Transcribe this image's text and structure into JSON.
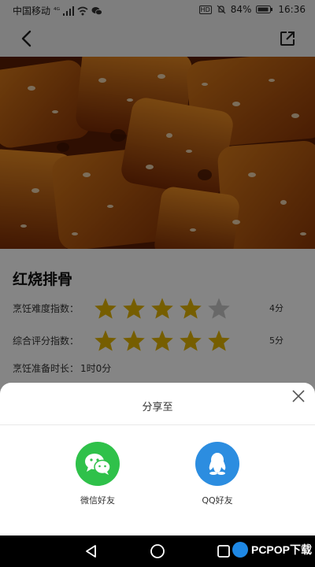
{
  "status_bar": {
    "carrier": "中国移动",
    "network": "⁴ᴳ",
    "hd": "HD",
    "battery": "84%",
    "time": "16:36"
  },
  "navbar": {
    "back_icon": "chevron-left-icon",
    "share_icon": "share-external-icon"
  },
  "recipe": {
    "title": "红烧排骨",
    "difficulty_label": "烹饪难度指数：",
    "difficulty_stars": 4,
    "difficulty_score": "4分",
    "rating_label": "综合评分指数：",
    "rating_stars": 5,
    "rating_score": "5分",
    "prep_label": "烹饪准备时长：",
    "prep_value": "1时0分"
  },
  "colors": {
    "star_filled": "#e2b400",
    "star_empty": "#c8c8c8",
    "wechat": "#2fc14a",
    "qq": "#2c8de0"
  },
  "share_sheet": {
    "title": "分享至",
    "options": [
      {
        "label": "微信好友",
        "icon": "wechat-icon"
      },
      {
        "label": "QQ好友",
        "icon": "qq-icon"
      }
    ]
  },
  "watermark": {
    "text": "PCPOP下载"
  }
}
